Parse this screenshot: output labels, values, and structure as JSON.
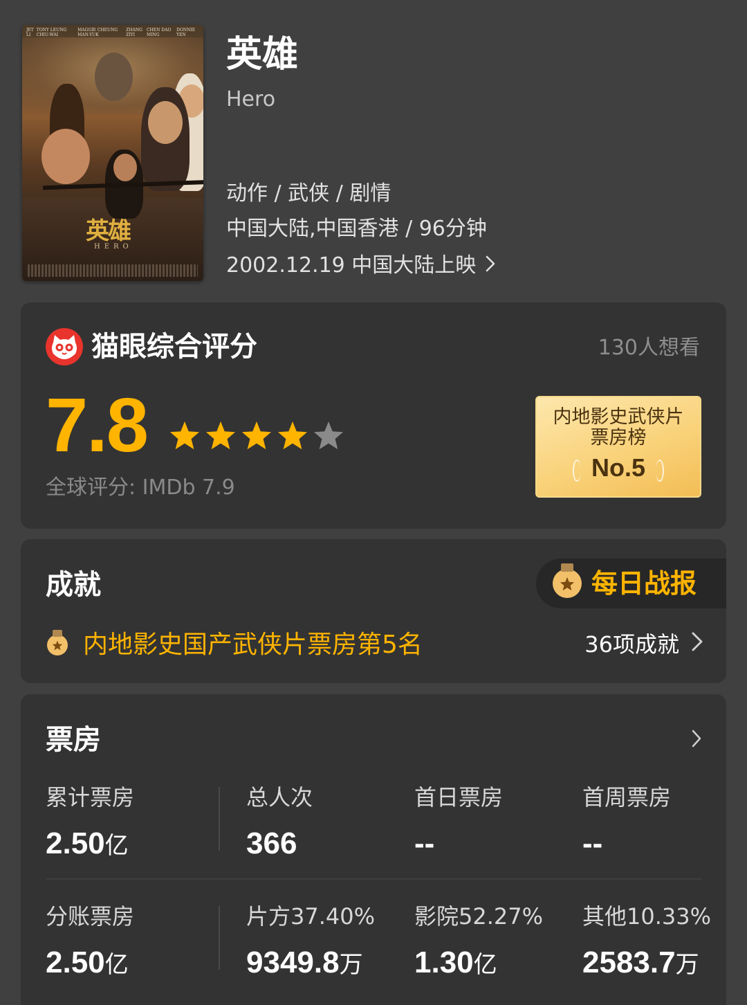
{
  "movie": {
    "poster": {
      "credits": [
        "JET LI",
        "TONY LEUNG CHIU-WAI",
        "MAGGIE CHEUNG MAN-YUK",
        "ZHANG ZIYI",
        "CHEN DAO MING",
        "DONNIE YEN"
      ],
      "title": "英雄",
      "subtitle": "HERO"
    },
    "title_cn": "英雄",
    "title_en": "Hero",
    "genres": "动作 / 武侠 / 剧情",
    "region_duration": "中国大陆,中国香港 / 96分钟",
    "release": "2002.12.19 中国大陆上映"
  },
  "rating": {
    "title": "猫眼综合评分",
    "wish_count": "130人想看",
    "score": "7.8",
    "stars_filled": 4,
    "stars_total": 5,
    "imdb": "全球评分: IMDb 7.9",
    "badge": {
      "line1": "内地影史武侠片",
      "line2": "票房榜",
      "rank": "No.5"
    }
  },
  "achievements": {
    "title": "成就",
    "daily_report": "每日战报",
    "highlight": "内地影史国产武侠片票房第5名",
    "count": "36项成就"
  },
  "box_office": {
    "title": "票房",
    "row1": [
      {
        "label": "累计票房",
        "value": "2.50",
        "unit": "亿"
      },
      {
        "label": "总人次",
        "value": "366",
        "unit": ""
      },
      {
        "label": "首日票房",
        "value": "--",
        "unit": ""
      },
      {
        "label": "首周票房",
        "value": "--",
        "unit": ""
      }
    ],
    "row2": [
      {
        "label": "分账票房",
        "value": "2.50",
        "unit": "亿"
      },
      {
        "label": "片方37.40%",
        "value": "9349.8",
        "unit": "万"
      },
      {
        "label": "影院52.27%",
        "value": "1.30",
        "unit": "亿"
      },
      {
        "label": "其他10.33%",
        "value": "2583.7",
        "unit": "万"
      }
    ]
  },
  "colors": {
    "background": "#404040",
    "card": "#333333",
    "accent": "#ffb400",
    "maoyan_red": "#e8342c"
  },
  "icons": [
    "chevron-right-icon",
    "maoyan-cat-icon",
    "star-icon",
    "medal-icon"
  ]
}
